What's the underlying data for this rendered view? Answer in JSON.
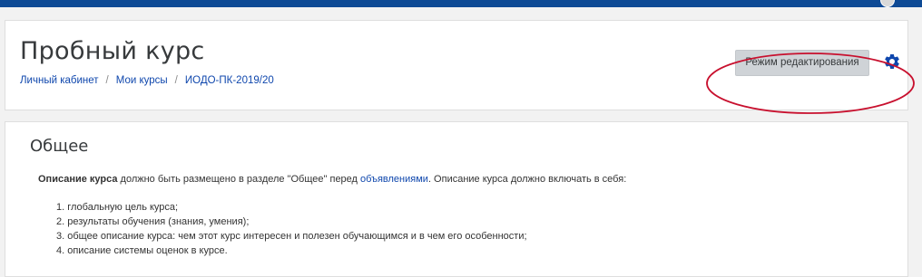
{
  "header": {
    "title": "Пробный курс",
    "breadcrumb": [
      {
        "label": "Личный кабинет"
      },
      {
        "label": "Мои курсы"
      },
      {
        "label": "ИОДО-ПК-2019/20"
      }
    ],
    "breadcrumb_separator": "/",
    "edit_mode_label": "Режим редактирования",
    "settings_icon": "gear-icon"
  },
  "section": {
    "title": "Общее",
    "description": {
      "strong": "Описание курса",
      "part1": " должно быть размещено в разделе \"Общее\" перед ",
      "link": "объявлениями",
      "part2": ". Описание курса должно включать в себя:"
    },
    "list": [
      "1. глобальную цель курса;",
      "2. результаты обучения (знания, умения);",
      "3. общее описание курса: чем этот курс интересен и полезен обучающимся и в чем его особенности;",
      "4. описание системы оценок в курсе."
    ]
  },
  "colors": {
    "navbar": "#0e4a95",
    "link": "#0f47ad",
    "annotation_ellipse": "#c8102e"
  }
}
